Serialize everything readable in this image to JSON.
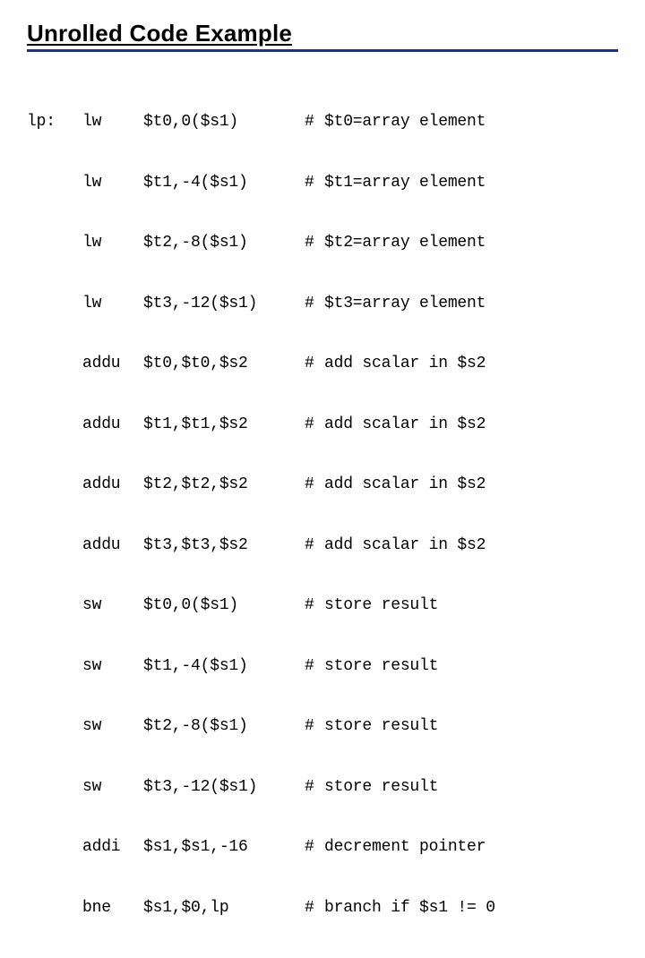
{
  "title": "Unrolled Code Example",
  "code": {
    "label": "lp:",
    "rows": [
      {
        "opcode": "lw",
        "operands": "$t0,0($s1)",
        "comment": "$t0=array element"
      },
      {
        "opcode": "lw",
        "operands": "$t1,-4($s1)",
        "comment": "$t1=array element"
      },
      {
        "opcode": "lw",
        "operands": "$t2,-8($s1)",
        "comment": "$t2=array element"
      },
      {
        "opcode": "lw",
        "operands": "$t3,-12($s1)",
        "comment": "$t3=array element"
      },
      {
        "opcode": "addu",
        "operands": "$t0,$t0,$s2",
        "comment": "add scalar in $s2"
      },
      {
        "opcode": "addu",
        "operands": "$t1,$t1,$s2",
        "comment": "add scalar in $s2"
      },
      {
        "opcode": "addu",
        "operands": "$t2,$t2,$s2",
        "comment": "add scalar in $s2"
      },
      {
        "opcode": "addu",
        "operands": "$t3,$t3,$s2",
        "comment": "add scalar in $s2"
      },
      {
        "opcode": "sw",
        "operands": "$t0,0($s1)",
        "comment": "store result"
      },
      {
        "opcode": "sw",
        "operands": "$t1,-4($s1)",
        "comment": "store result"
      },
      {
        "opcode": "sw",
        "operands": "$t2,-8($s1)",
        "comment": "store result"
      },
      {
        "opcode": "sw",
        "operands": "$t3,-12($s1)",
        "comment": "store result"
      },
      {
        "opcode": "addi",
        "operands": "$s1,$s1,-16",
        "comment": "decrement pointer"
      },
      {
        "opcode": "bne",
        "operands": "$s1,$0,lp",
        "comment": "branch if $s1 != 0"
      }
    ]
  }
}
